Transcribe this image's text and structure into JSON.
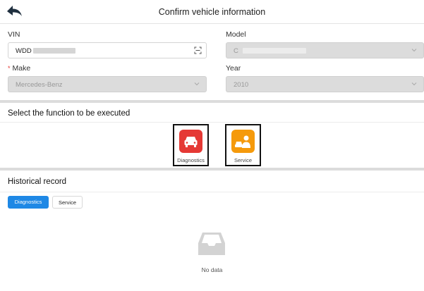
{
  "header": {
    "title": "Confirm vehicle information",
    "back_icon": "back-arrow-icon"
  },
  "form": {
    "vin": {
      "label": "VIN",
      "value": "WDD"
    },
    "model": {
      "label": "Model",
      "value": "C"
    },
    "make": {
      "label": "Make",
      "required_mark": "*",
      "value": "Mercedes-Benz"
    },
    "year": {
      "label": "Year",
      "value": "2010"
    }
  },
  "functions": {
    "title": "Select the function to be executed",
    "items": [
      {
        "label": "Diagnostics",
        "icon": "car-icon",
        "color": "#e53935"
      },
      {
        "label": "Service",
        "icon": "technician-icon",
        "color": "#f59a0c"
      }
    ]
  },
  "history": {
    "title": "Historical record",
    "tabs": [
      {
        "label": "Diagnostics",
        "active": true
      },
      {
        "label": "Service",
        "active": false
      }
    ],
    "empty_text": "No data"
  },
  "colors": {
    "accent": "#1e88e5",
    "required": "#e53935"
  }
}
